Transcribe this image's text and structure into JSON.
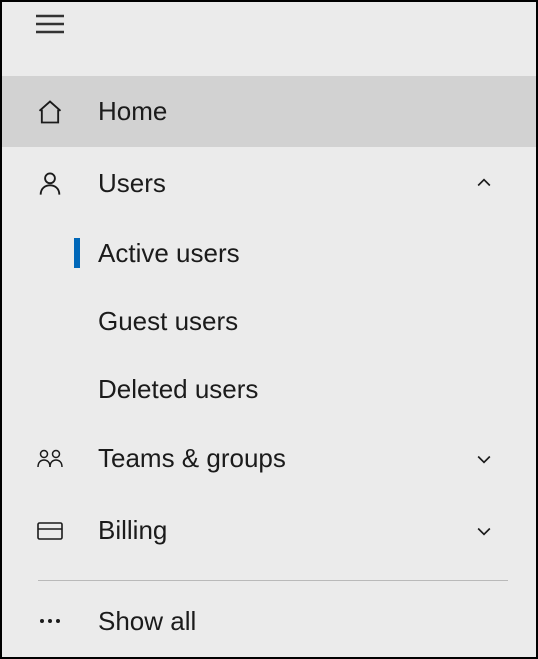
{
  "nav": {
    "home": {
      "label": "Home"
    },
    "users": {
      "label": "Users",
      "expanded": true,
      "items": [
        {
          "label": "Active users",
          "active": true
        },
        {
          "label": "Guest users",
          "active": false
        },
        {
          "label": "Deleted users",
          "active": false
        }
      ]
    },
    "teams": {
      "label": "Teams & groups",
      "expanded": false
    },
    "billing": {
      "label": "Billing",
      "expanded": false
    },
    "show_all": {
      "label": "Show all"
    }
  }
}
